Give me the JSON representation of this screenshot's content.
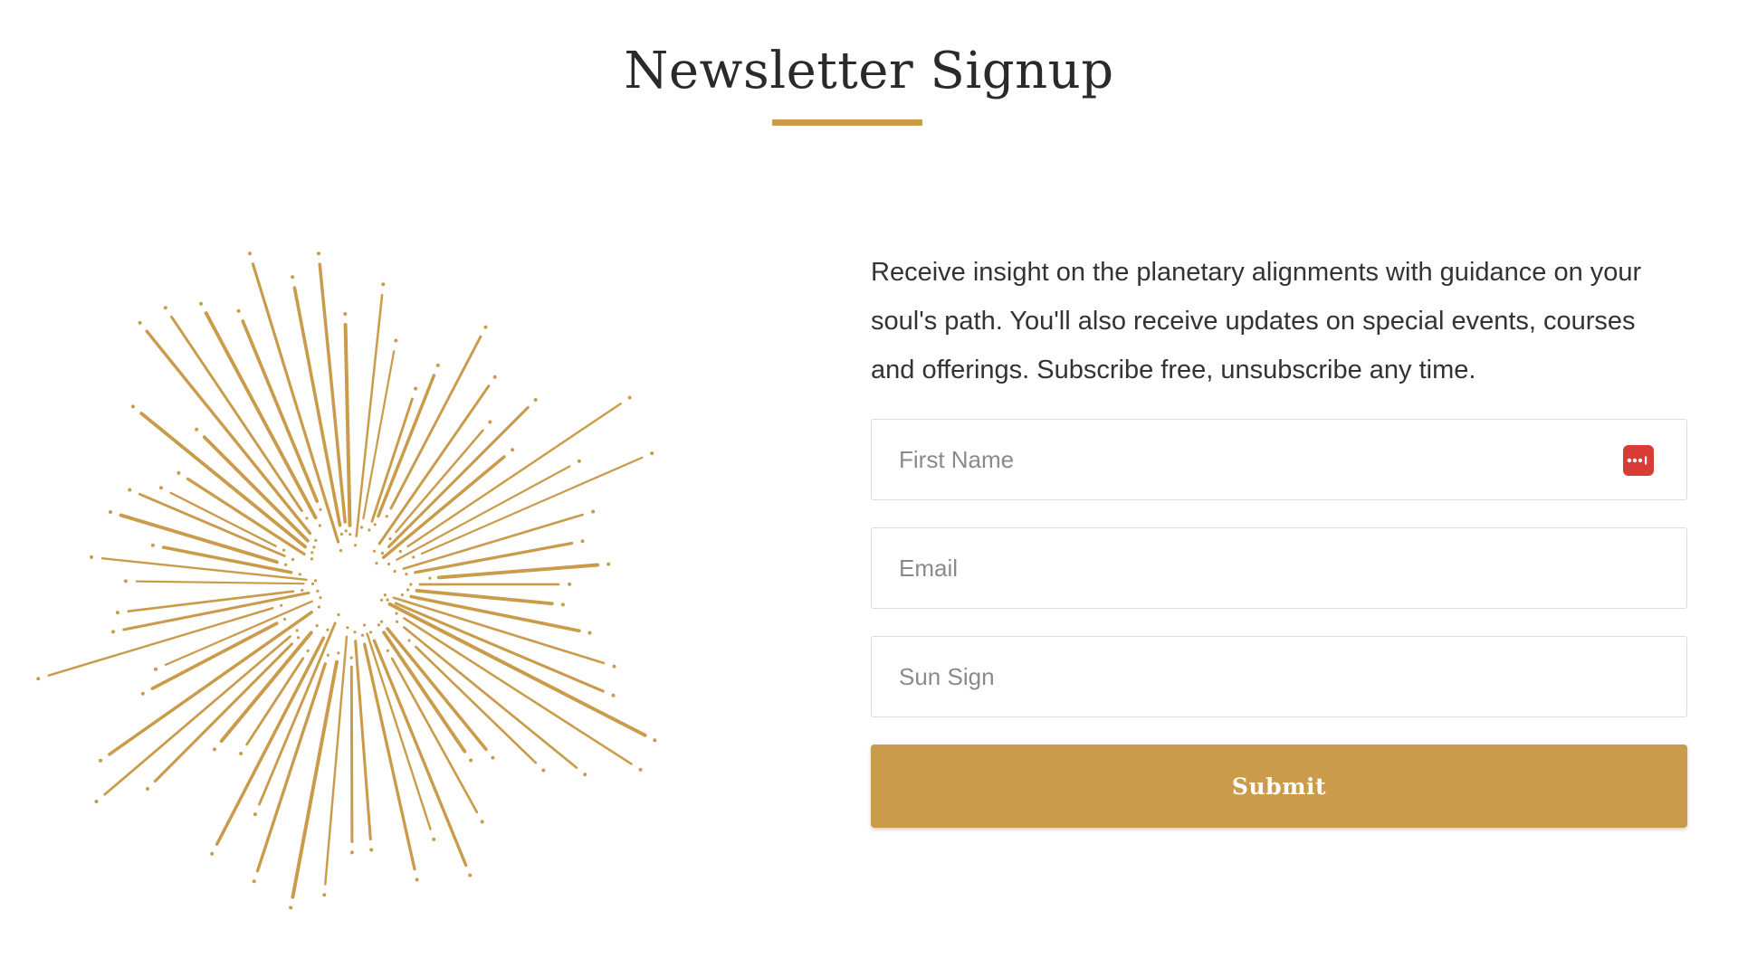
{
  "page": {
    "title": "Newsletter Signup",
    "description": "Receive insight on the planetary alignments with guidance on your soul's path. You'll also receive updates on special events, courses and offerings. Subscribe free, unsubscribe any time."
  },
  "form": {
    "first_name": {
      "placeholder": "First Name",
      "value": ""
    },
    "email": {
      "placeholder": "Email",
      "value": ""
    },
    "sun_sign": {
      "placeholder": "Sun Sign",
      "value": ""
    },
    "submit_label": "Submit"
  },
  "icons": {
    "decoration": "starburst-illustration",
    "autofill": "password-manager-autofill-icon"
  },
  "colors": {
    "accent": "#c99b4a",
    "text": "#333333",
    "autofill_icon": "#d73c36"
  }
}
